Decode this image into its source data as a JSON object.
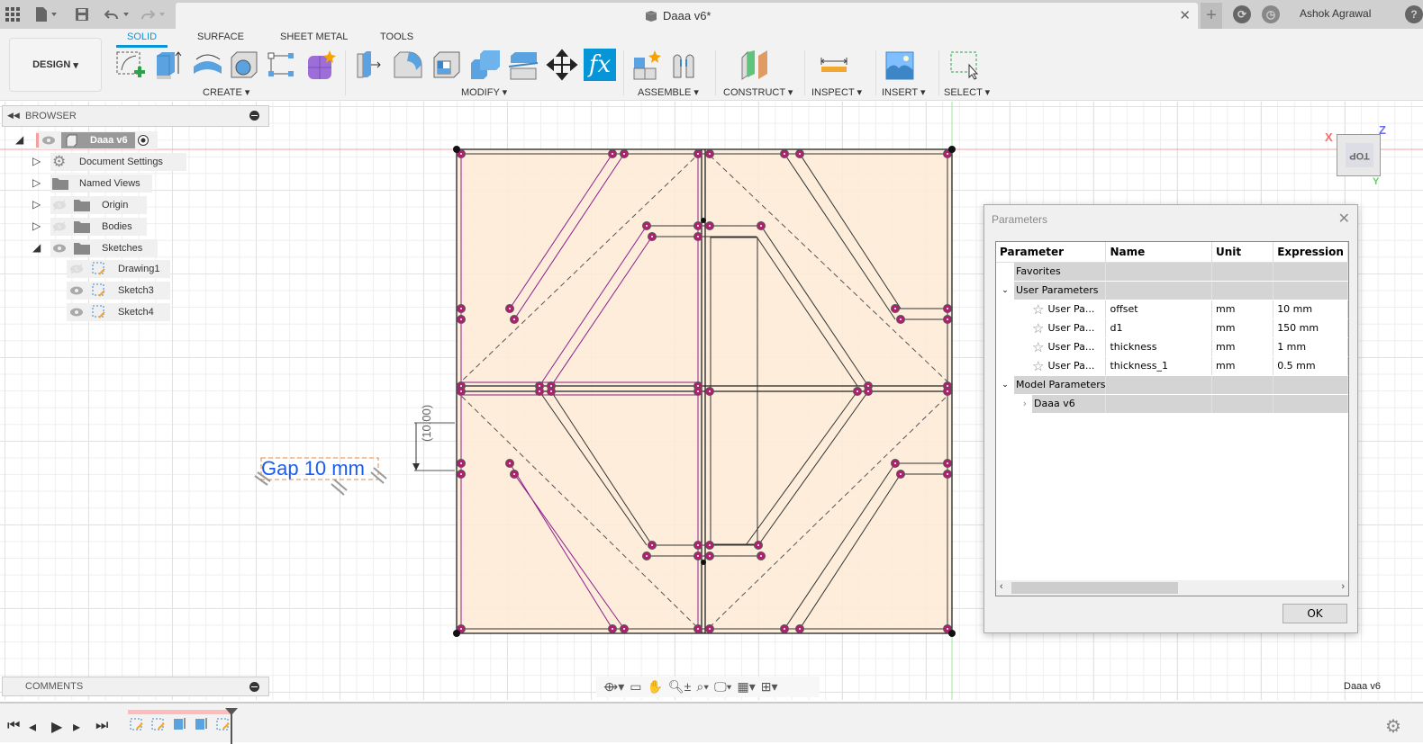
{
  "window": {
    "title": "Daaa v6*",
    "user": "Ashok Agrawal",
    "help_label": "?"
  },
  "ribbon": {
    "workspace": "DESIGN",
    "tabs": [
      {
        "label": "SOLID",
        "active": true
      },
      {
        "label": "SURFACE",
        "active": false
      },
      {
        "label": "SHEET METAL",
        "active": false
      },
      {
        "label": "TOOLS",
        "active": false
      }
    ],
    "groups": [
      {
        "label": "CREATE"
      },
      {
        "label": "MODIFY"
      },
      {
        "label": "ASSEMBLE"
      },
      {
        "label": "CONSTRUCT"
      },
      {
        "label": "INSPECT"
      },
      {
        "label": "INSERT"
      },
      {
        "label": "SELECT"
      }
    ],
    "accent": "#0696d7"
  },
  "browser": {
    "title": "BROWSER",
    "root": "Daaa v6",
    "items": [
      {
        "label": "Document Settings",
        "icon": "gear-icon"
      },
      {
        "label": "Named Views",
        "icon": "folder-icon"
      },
      {
        "label": "Origin",
        "icon": "folder-icon",
        "visible": false
      },
      {
        "label": "Bodies",
        "icon": "folder-icon",
        "visible": false
      },
      {
        "label": "Sketches",
        "icon": "folder-icon",
        "visible": true,
        "expanded": true
      }
    ],
    "sketches": [
      {
        "label": "Drawing1",
        "visible": false
      },
      {
        "label": "Sketch3",
        "visible": true
      },
      {
        "label": "Sketch4",
        "visible": true
      }
    ]
  },
  "comments": {
    "title": "COMMENTS"
  },
  "canvas": {
    "annotation_text": "Gap 10 mm",
    "dimension_text": "(10.00)",
    "viewcube_face": "TOP",
    "axis_x": "X",
    "axis_y": "Y",
    "axis_z": "Z",
    "document_label": "Daaa v6"
  },
  "parameters_dialog": {
    "title": "Parameters",
    "columns": [
      "Parameter",
      "Name",
      "Unit",
      "Expression"
    ],
    "favorites_label": "Favorites",
    "user_group_label": "User Parameters",
    "user_params": [
      {
        "type": "User Pa...",
        "name": "offset",
        "unit": "mm",
        "expression": "10 mm"
      },
      {
        "type": "User Pa...",
        "name": "d1",
        "unit": "mm",
        "expression": "150 mm"
      },
      {
        "type": "User Pa...",
        "name": "thickness",
        "unit": "mm",
        "expression": "1 mm"
      },
      {
        "type": "User Pa...",
        "name": "thickness_1",
        "unit": "mm",
        "expression": "0.5 mm"
      }
    ],
    "model_group_label": "Model Parameters",
    "model_child": "Daaa v6",
    "ok_label": "OK"
  }
}
